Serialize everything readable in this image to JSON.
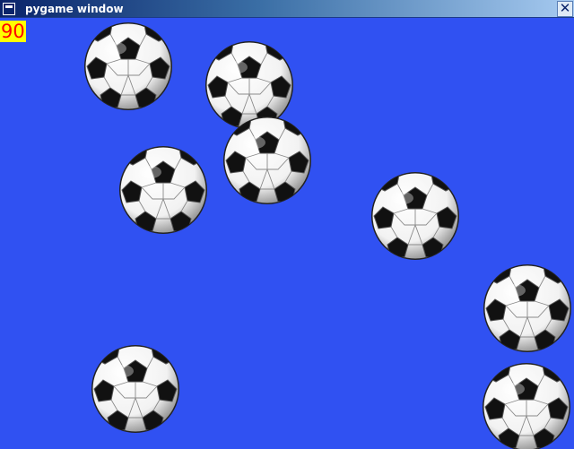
{
  "window": {
    "title": "pygame window",
    "close_glyph": "✕",
    "icon": "window-menu-icon"
  },
  "game": {
    "background_color": "#3051f2",
    "score": "90",
    "score_text_color": "#ff0000",
    "score_background_color": "#ffff00",
    "ball_icon": "soccer-ball-icon",
    "ball_count": 8
  }
}
